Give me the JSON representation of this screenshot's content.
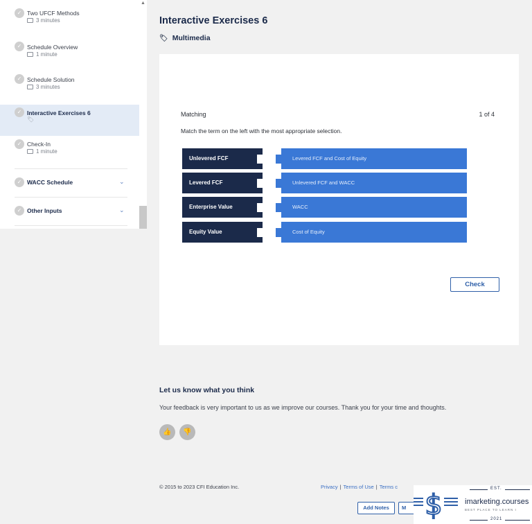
{
  "sidebar": {
    "items": [
      {
        "title": "Two UFCF Methods",
        "meta": "3 minutes"
      },
      {
        "title": "Schedule Overview",
        "meta": "1 minute"
      },
      {
        "title": "Schedule Solution",
        "meta": "3 minutes"
      },
      {
        "title": "Interactive Exercises 6",
        "meta": ""
      },
      {
        "title": "Check-In",
        "meta": "1 minute"
      }
    ],
    "sections": [
      {
        "title": "WACC Schedule"
      },
      {
        "title": "Other Inputs"
      }
    ]
  },
  "lesson": {
    "title": "Interactive Exercises 6",
    "type": "Multimedia"
  },
  "exercise": {
    "kind": "Matching",
    "count": "1 of 4",
    "instruction": "Match the term on the left with the most appropriate selection.",
    "terms": [
      "Unlevered FCF",
      "Levered FCF",
      "Enterprise Value",
      "Equity Value"
    ],
    "matches": [
      "Levered FCF and Cost of Equity",
      "Unlevered FCF and WACC",
      "WACC",
      "Cost of Equity"
    ],
    "check_label": "Check"
  },
  "feedback": {
    "title": "Let us know what you think",
    "text": "Your feedback is very important to us as we improve our courses. Thank you for your time and thoughts."
  },
  "footer": {
    "copyright": "© 2015 to 2023 CFI Education Inc.",
    "privacy": "Privacy",
    "terms": "Terms of Use",
    "terms_partial": "Terms c",
    "add_notes": "Add Notes",
    "second_button": "M"
  },
  "watermark": {
    "est": "EST.",
    "brand": "imarketing.courses",
    "tagline": "BEST PLACE TO LEARN I",
    "year": "2021"
  },
  "colors": {
    "navy": "#1b2a4a",
    "accent_blue": "#3a78d6",
    "active_row": "#e3ebf6",
    "link_blue": "#3a6fc4"
  }
}
